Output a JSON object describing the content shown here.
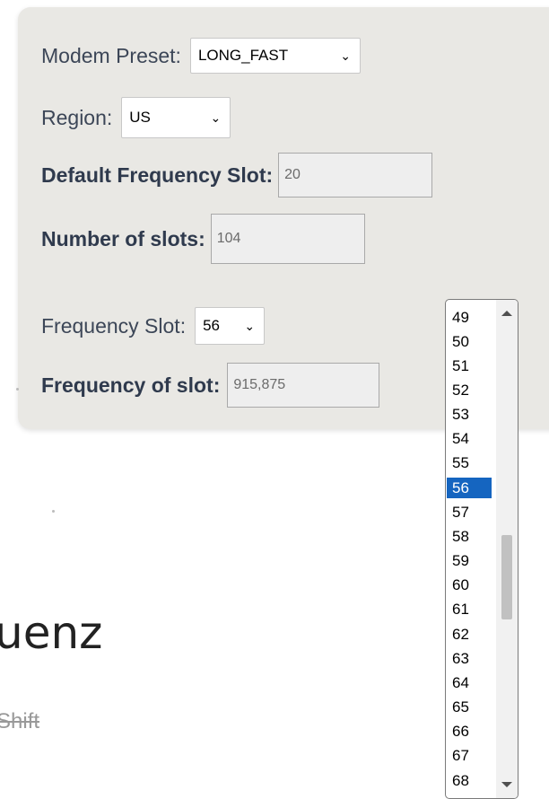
{
  "form": {
    "modem_preset_label": "Modem Preset:",
    "modem_preset_value": "LONG_FAST",
    "region_label": "Region:",
    "region_value": "US",
    "default_slot_label": "Default Frequency Slot:",
    "default_slot_value": "20",
    "num_slots_label": "Number of slots:",
    "num_slots_value": "104",
    "freq_slot_label": "Frequency Slot:",
    "freq_slot_value": "56",
    "freq_of_slot_label": "Frequency of slot:",
    "freq_of_slot_value": "915,875"
  },
  "slot_options": [
    "49",
    "50",
    "51",
    "52",
    "53",
    "54",
    "55",
    "56",
    "57",
    "58",
    "59",
    "60",
    "61",
    "62",
    "63",
    "64",
    "65",
    "66",
    "67",
    "68"
  ],
  "selected_option": "56",
  "background": {
    "heading_fragment": "uenz",
    "subtext_fragment": "Shift"
  },
  "colors": {
    "panel_bg": "#e9e8e4",
    "selected_bg": "#1565c0",
    "label_text": "#2f3a4d"
  }
}
